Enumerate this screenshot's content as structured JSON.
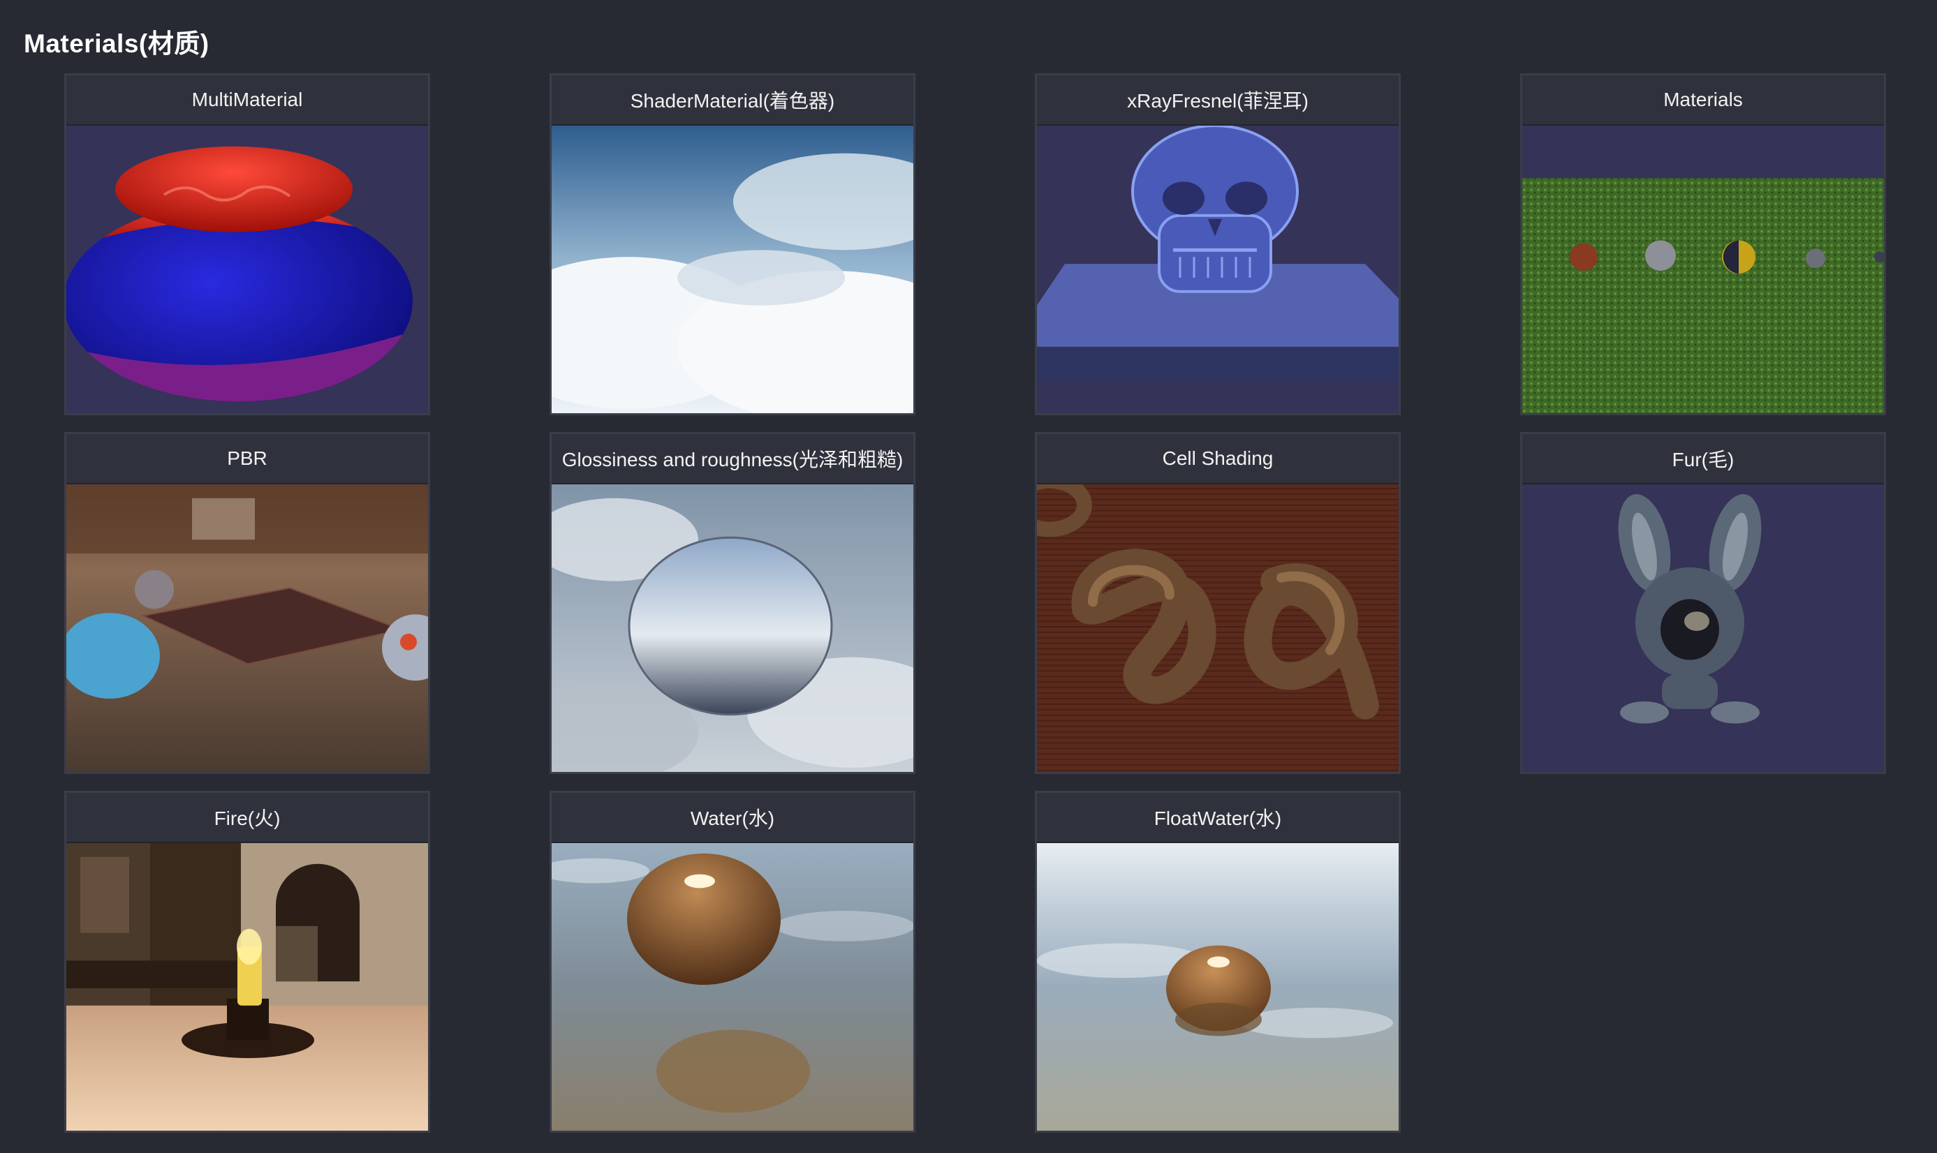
{
  "section": {
    "title": "Materials(材质)"
  },
  "cards": [
    {
      "title": "MultiMaterial",
      "scene": "multimaterial-sphere"
    },
    {
      "title": "ShaderMaterial(着色器)",
      "scene": "sky-clouds"
    },
    {
      "title": "xRayFresnel(菲涅耳)",
      "scene": "xray-skull"
    },
    {
      "title": "Materials",
      "scene": "spheres-on-grass"
    },
    {
      "title": "PBR",
      "scene": "pbr-room"
    },
    {
      "title": "Glossiness and roughness(光泽和粗糙)",
      "scene": "glossy-sphere-clouds"
    },
    {
      "title": "Cell Shading",
      "scene": "toon-knots"
    },
    {
      "title": "Fur(毛)",
      "scene": "fur-rabbit"
    },
    {
      "title": "Fire(火)",
      "scene": "candle-fire"
    },
    {
      "title": "Water(水)",
      "scene": "water-sphere"
    },
    {
      "title": "FloatWater(水)",
      "scene": "float-water-sphere"
    }
  ]
}
